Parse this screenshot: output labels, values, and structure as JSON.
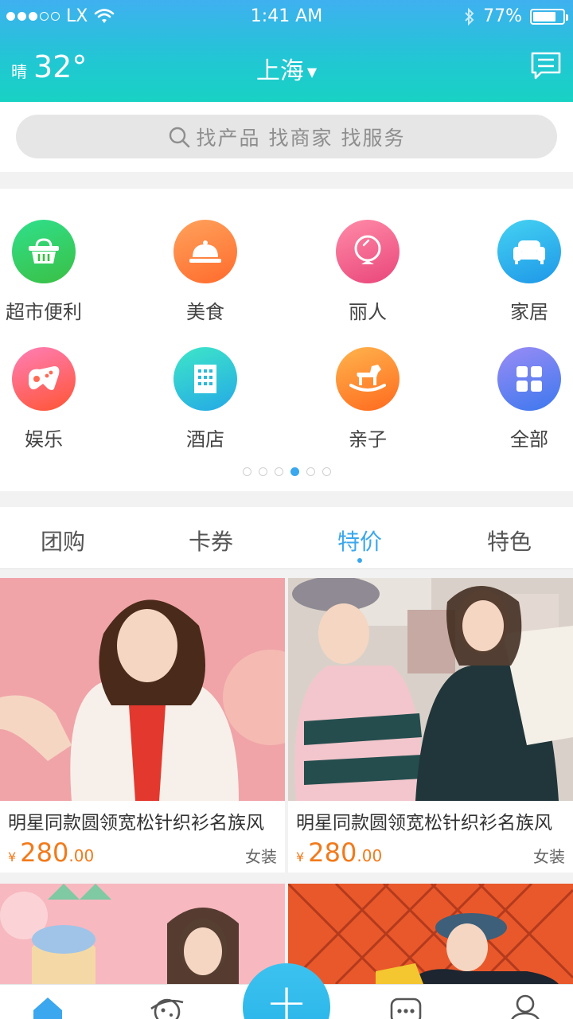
{
  "status_bar": {
    "carrier": "LX",
    "time": "1:41 AM",
    "battery": "77%",
    "battery_level": 0.77
  },
  "header": {
    "weather_condition": "晴",
    "temperature": "32°",
    "city": "上海",
    "message_icon": "chat-bubble-icon"
  },
  "search": {
    "placeholder": "找产品 找商家 找服务"
  },
  "categories": [
    {
      "label": "超市便利",
      "icon": "basket-icon",
      "color_from": "#2fe08c",
      "color_to": "#3bbf44"
    },
    {
      "label": "美食",
      "icon": "food-cloche-icon",
      "color_from": "#ffa25c",
      "color_to": "#ff6b2c"
    },
    {
      "label": "丽人",
      "icon": "mirror-icon",
      "color_from": "#ff8ba8",
      "color_to": "#e9467a"
    },
    {
      "label": "家居",
      "icon": "sofa-icon",
      "color_from": "#45d2f2",
      "color_to": "#1e97e8"
    },
    {
      "label": "娱乐",
      "icon": "gamepad-icon",
      "color_from": "#ff7fb8",
      "color_to": "#ff5433"
    },
    {
      "label": "酒店",
      "icon": "building-icon",
      "color_from": "#3ee6c8",
      "color_to": "#24a9e6"
    },
    {
      "label": "亲子",
      "icon": "rocking-horse-icon",
      "color_from": "#ffb44d",
      "color_to": "#ff6a1e"
    },
    {
      "label": "全部",
      "icon": "grid-icon",
      "color_from": "#9a8cf5",
      "color_to": "#3c78ee"
    }
  ],
  "pager": {
    "count": 6,
    "active_index": 3
  },
  "tabs": [
    {
      "label": "团购"
    },
    {
      "label": "卡券"
    },
    {
      "label": "特价"
    },
    {
      "label": "特色"
    }
  ],
  "active_tab": "特价",
  "products": [
    {
      "title": "明星同款圆领宽松针织衫名族风",
      "currency": "¥",
      "price_int": "280",
      "price_dec": ".00",
      "category": "女装"
    },
    {
      "title": "明星同款圆领宽松针织衫名族风",
      "currency": "¥",
      "price_int": "280",
      "price_dec": ".00",
      "category": "女装"
    }
  ],
  "bottom_nav": [
    {
      "icon": "home-icon"
    },
    {
      "icon": "planet-icon"
    },
    {
      "icon": "plus-icon"
    },
    {
      "icon": "message-icon"
    },
    {
      "icon": "user-icon"
    }
  ],
  "colors": {
    "accent": "#3aa7ee",
    "price": "#f27a1a"
  }
}
